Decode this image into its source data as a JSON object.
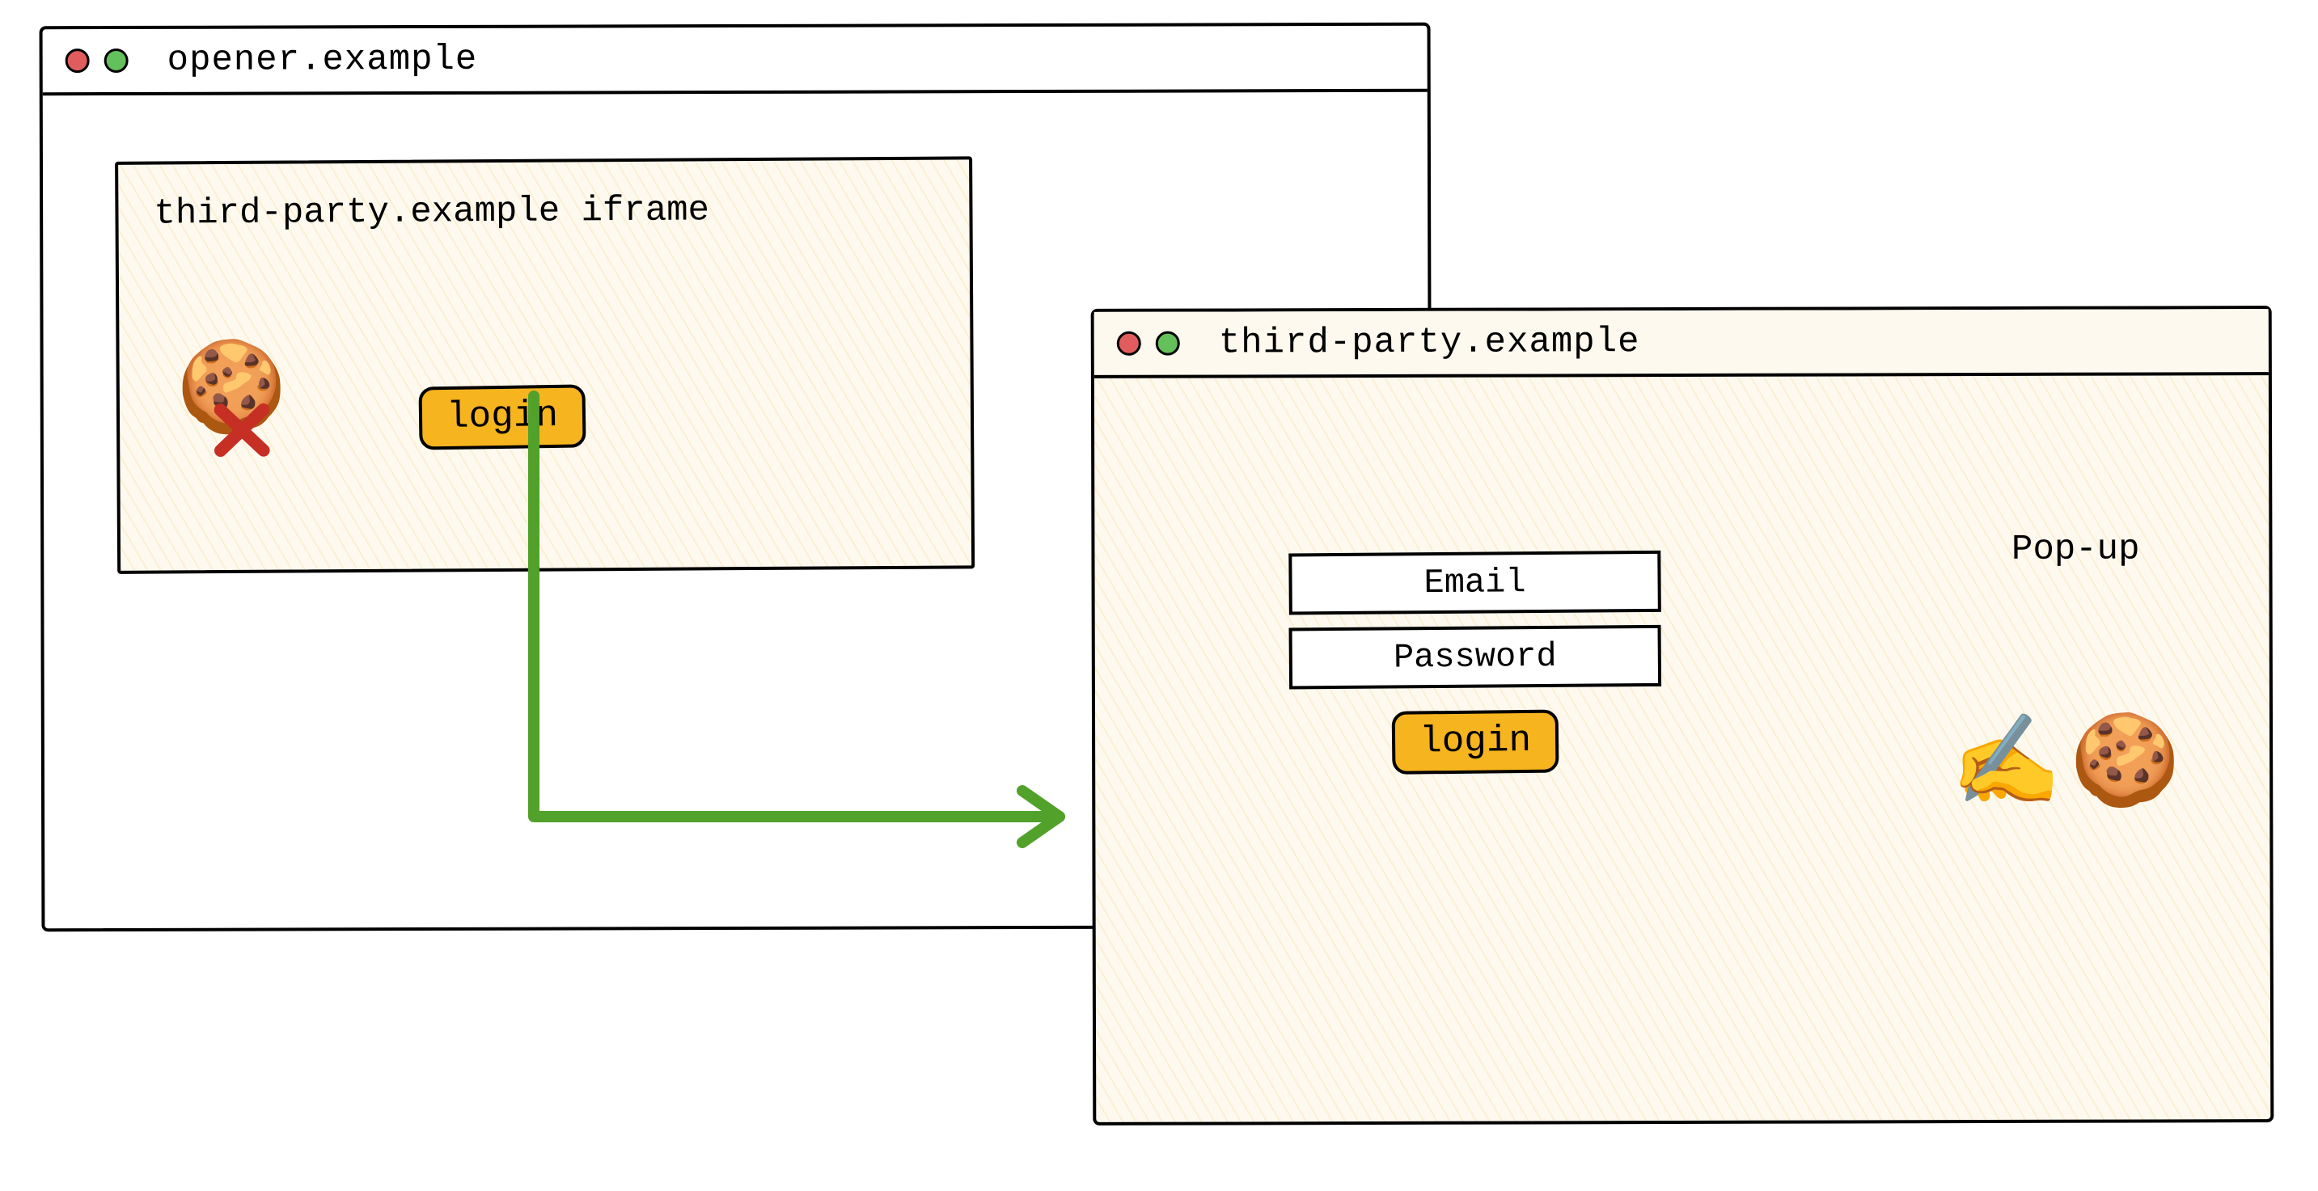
{
  "mainWindow": {
    "title": "opener.example",
    "iframe": {
      "label": "third-party.example iframe",
      "loginButton": "login"
    }
  },
  "popupWindow": {
    "title": "third-party.example",
    "emailPlaceholder": "Email",
    "passwordPlaceholder": "Password",
    "loginButton": "login",
    "label": "Pop-up"
  },
  "icons": {
    "cookieBlocked": "🍪",
    "cross": "✖",
    "writingHand": "✍️",
    "cookieSet": "🍪"
  }
}
